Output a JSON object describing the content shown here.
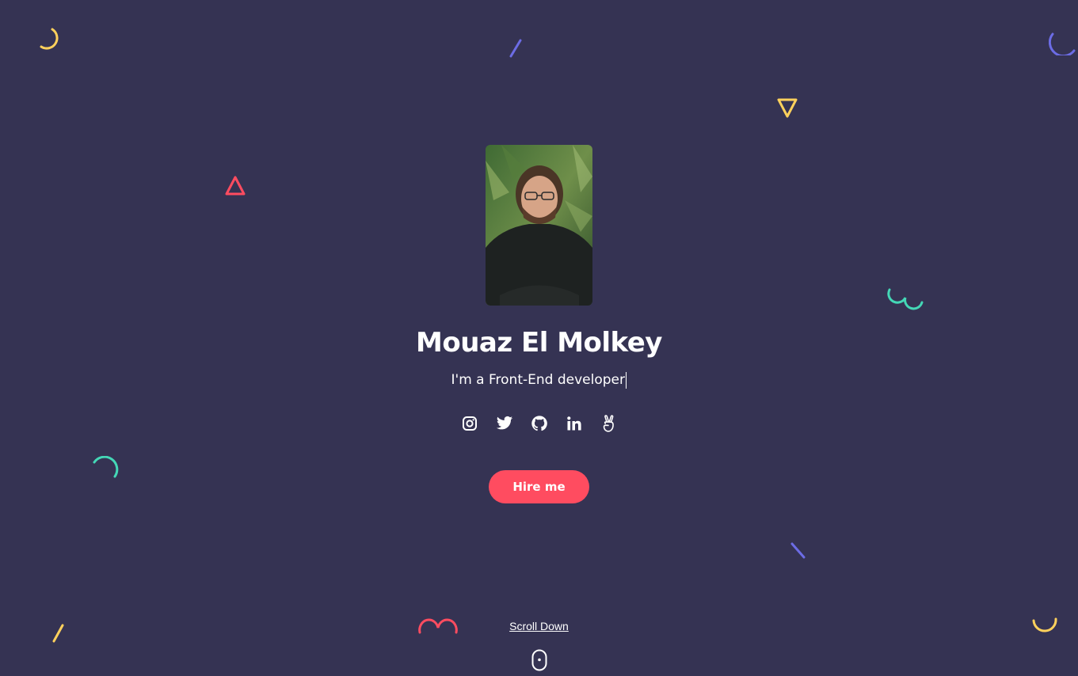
{
  "profile": {
    "name": "Mouaz El Molkey",
    "tagline": "I'm a Front-End developer"
  },
  "socials": [
    {
      "icon": "instagram-icon"
    },
    {
      "icon": "twitter-icon"
    },
    {
      "icon": "github-icon"
    },
    {
      "icon": "linkedin-icon"
    },
    {
      "icon": "angellist-icon"
    }
  ],
  "hero": {
    "hire_label": "Hire me"
  },
  "scroll": {
    "label": "Scroll Down"
  },
  "colors": {
    "background": "#353353",
    "accent": "#ff4c60",
    "yellow": "#ffd15c",
    "purple": "#6c6ce5",
    "teal": "#44d7b6",
    "text": "#ffffff"
  }
}
